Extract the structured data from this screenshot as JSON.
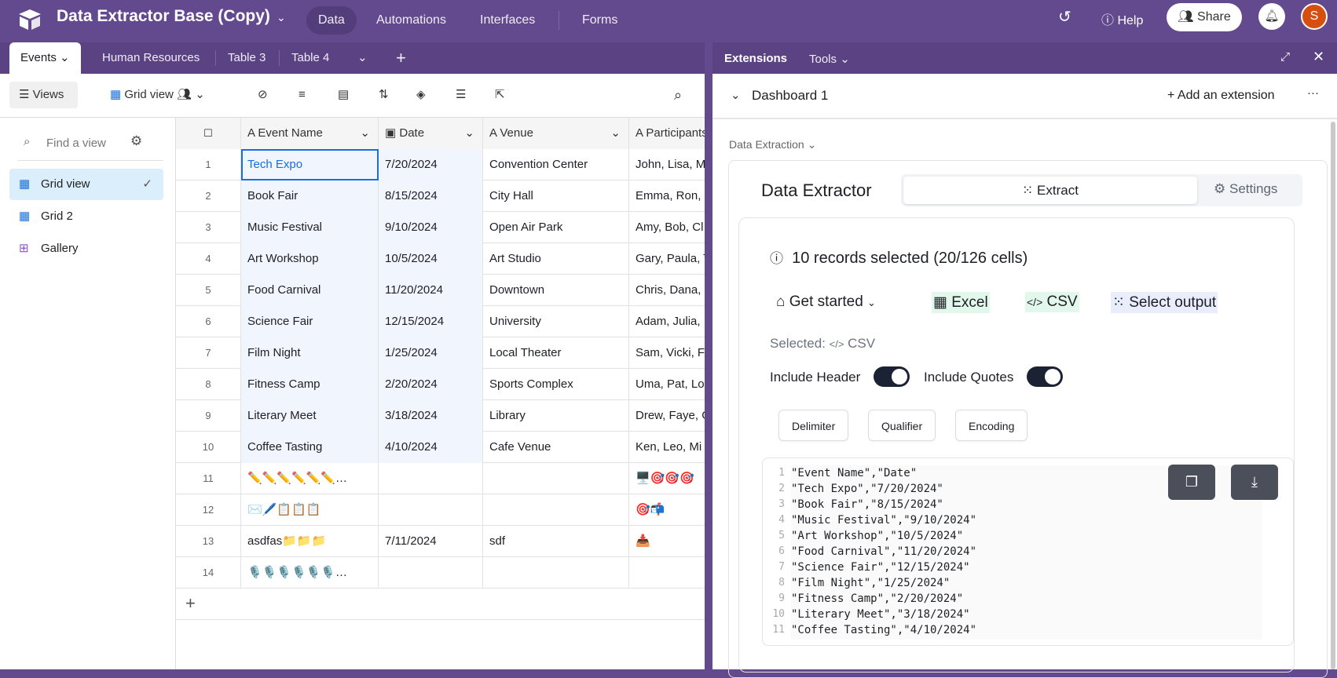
{
  "app": {
    "title": "Data Extractor Base (Copy)",
    "nav": [
      "Data",
      "Automations",
      "Interfaces",
      "Forms"
    ],
    "help": "Help",
    "share": "Share",
    "avatar": "S"
  },
  "tables": {
    "tabs": [
      "Events",
      "Human Resources",
      "Table 3",
      "Table 4"
    ]
  },
  "toolbar": {
    "views": "Views",
    "view_name": "Grid view"
  },
  "sidebar": {
    "find_placeholder": "Find a view",
    "items": [
      {
        "label": "Grid view"
      },
      {
        "label": "Grid 2"
      },
      {
        "label": "Gallery"
      }
    ]
  },
  "grid": {
    "columns": [
      "Event Name",
      "Date",
      "Venue",
      "Participants"
    ],
    "rows": [
      [
        "1",
        "Tech Expo",
        "7/20/2024",
        "Convention Center",
        "John, Lisa, M"
      ],
      [
        "2",
        "Book Fair",
        "8/15/2024",
        "City Hall",
        "Emma, Ron,"
      ],
      [
        "3",
        "Music Festival",
        "9/10/2024",
        "Open Air Park",
        "Amy, Bob, Cl"
      ],
      [
        "4",
        "Art Workshop",
        "10/5/2024",
        "Art Studio",
        "Gary, Paula, T"
      ],
      [
        "5",
        "Food Carnival",
        "11/20/2024",
        "Downtown",
        "Chris, Dana,"
      ],
      [
        "6",
        "Science Fair",
        "12/15/2024",
        "University",
        "Adam, Julia,"
      ],
      [
        "7",
        "Film Night",
        "1/25/2024",
        "Local Theater",
        "Sam, Vicki, F"
      ],
      [
        "8",
        "Fitness Camp",
        "2/20/2024",
        "Sports Complex",
        "Uma, Pat, Lo"
      ],
      [
        "9",
        "Literary Meet",
        "3/18/2024",
        "Library",
        "Drew, Faye, G"
      ],
      [
        "10",
        "Coffee Tasting",
        "4/10/2024",
        "Cafe Venue",
        "Ken, Leo, Mi"
      ],
      [
        "11",
        "✏️✏️✏️✏️✏️✏️…",
        "",
        "",
        "🖥️🎯🎯🎯"
      ],
      [
        "12",
        "✉️🖊️📋📋📋",
        "",
        "",
        "🎯📬"
      ],
      [
        "13",
        "asdfas📁📁📁",
        "7/11/2024",
        "sdf",
        "📥"
      ],
      [
        "14",
        "🎙️🎙️🎙️🎙️🎙️🎙️…",
        "",
        "",
        ""
      ]
    ]
  },
  "extensions": {
    "tab": "Extensions",
    "tools": "Tools",
    "dashboard": "Dashboard 1",
    "add": "Add an extension",
    "section": "Data Extraction",
    "title": "Data Extractor",
    "tab_extract": "Extract",
    "tab_settings": "Settings",
    "info": "10 records selected (20/126 cells)",
    "get_started": "Get started",
    "excel": "Excel",
    "csv": "CSV",
    "select_output": "Select output",
    "selected_label": "Selected:",
    "selected_value": "CSV",
    "include_header": "Include Header",
    "include_quotes": "Include Quotes",
    "include_header_on": true,
    "include_quotes_on": true,
    "options": [
      "Delimiter",
      "Qualifier",
      "Encoding"
    ],
    "code": [
      "\"Event Name\",\"Date\"",
      "\"Tech Expo\",\"7/20/2024\"",
      "\"Book Fair\",\"8/15/2024\"",
      "\"Music Festival\",\"9/10/2024\"",
      "\"Art Workshop\",\"10/5/2024\"",
      "\"Food Carnival\",\"11/20/2024\"",
      "\"Science Fair\",\"12/15/2024\"",
      "\"Film Night\",\"1/25/2024\"",
      "\"Fitness Camp\",\"2/20/2024\"",
      "\"Literary Meet\",\"3/18/2024\"",
      "\"Coffee Tasting\",\"4/10/2024\""
    ]
  },
  "colors": {
    "brand": "#63498d",
    "accent": "#166ee1",
    "toggle": "#1b2234"
  }
}
